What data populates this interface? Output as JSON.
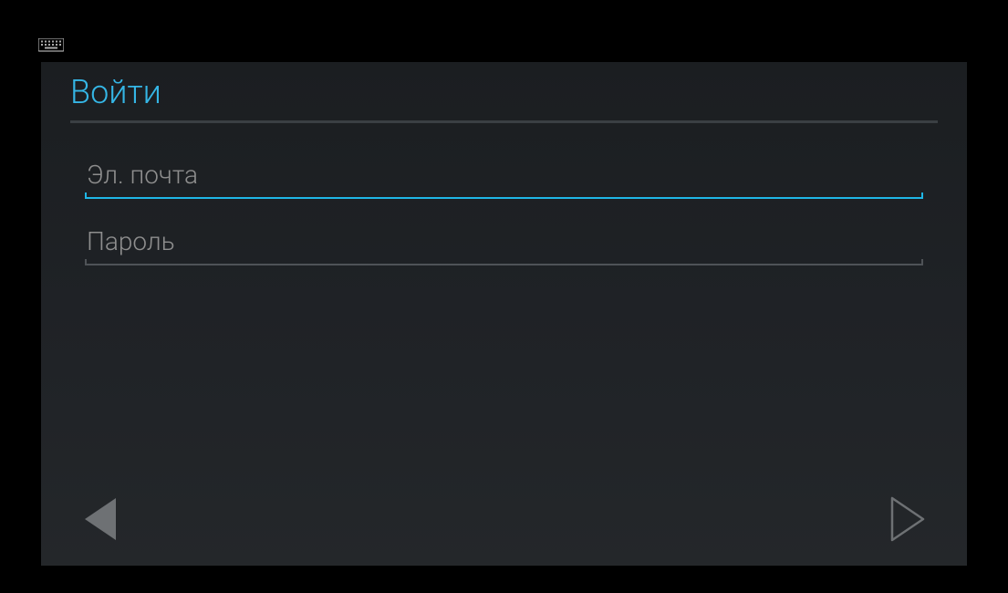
{
  "header": {
    "title": "Войти"
  },
  "form": {
    "email": {
      "placeholder": "Эл. почта",
      "value": ""
    },
    "password": {
      "placeholder": "Пароль",
      "value": ""
    }
  },
  "icons": {
    "keyboard": "keyboard-icon",
    "back": "triangle-left-icon",
    "forward": "triangle-right-icon"
  },
  "colors": {
    "accent": "#35b6e6",
    "focus_underline": "#1fb6e6",
    "placeholder": "#8e8e8e",
    "divider": "#3a3f43"
  }
}
